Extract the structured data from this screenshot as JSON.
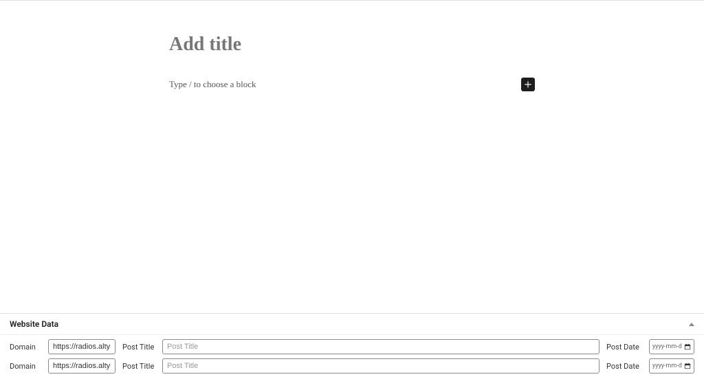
{
  "editor": {
    "title_placeholder": "Add title",
    "block_placeholder": "Type / to choose a block"
  },
  "metabox": {
    "panel_title": "Website Data",
    "labels": {
      "domain": "Domain",
      "post_title": "Post Title",
      "post_date": "Post Date"
    },
    "rows": [
      {
        "domain_value": "https://radios.altyra.cor",
        "post_title_placeholder": "Post Title",
        "date_placeholder": "yyyy-mm-d"
      },
      {
        "domain_value": "https://radios.altyra.cor",
        "post_title_placeholder": "Post Title",
        "date_placeholder": "yyyy-mm-d"
      }
    ]
  }
}
